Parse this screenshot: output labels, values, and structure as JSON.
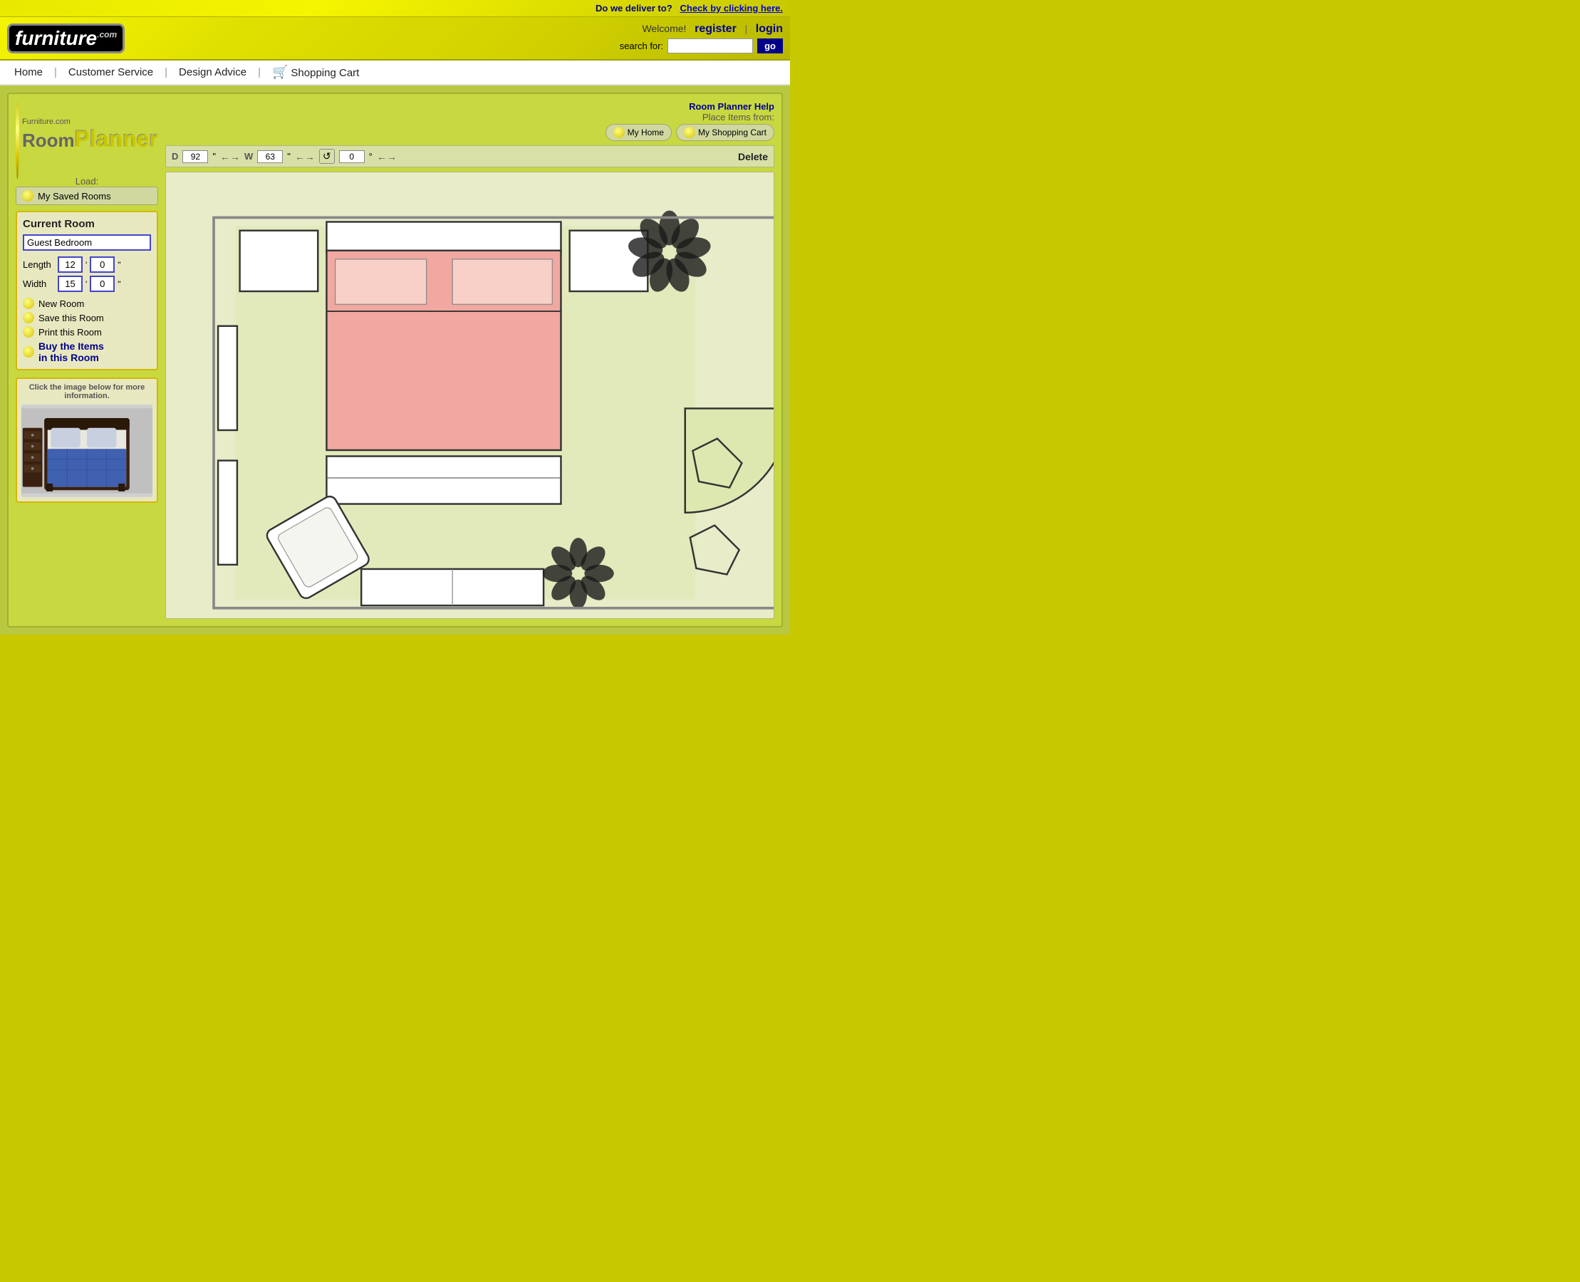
{
  "topbar": {
    "deliver_prompt": "Do we deliver to?",
    "deliver_link": "Check by clicking here."
  },
  "header": {
    "logo_brand": "furniture",
    "logo_com": ".com",
    "welcome": "Welcome!",
    "register": "register",
    "pipe": "|",
    "login": "login",
    "search_label": "search for:",
    "search_placeholder": "",
    "go_button": "go"
  },
  "nav": {
    "items": [
      {
        "label": "Home"
      },
      {
        "label": "Customer Service"
      },
      {
        "label": "Design Advice"
      },
      {
        "label": "Shopping Cart"
      }
    ]
  },
  "planner": {
    "logo_site": "Furniture.com",
    "logo_room": "Room",
    "logo_planner": "Planner",
    "load_label": "Load:",
    "load_btn": "My Saved Rooms",
    "help_link": "Room Planner Help",
    "place_label": "Place Items from:",
    "place_btn1": "My Home",
    "place_btn2": "My Shopping Cart",
    "dim_d_label": "D",
    "dim_d_value": "92",
    "dim_d_unit": "\"",
    "dim_w_label": "W",
    "dim_w_value": "63",
    "dim_w_unit": "\"",
    "dim_rot_value": "0",
    "dim_rot_unit": "°",
    "delete_label": "Delete",
    "current_room_title": "Current Room",
    "room_name": "Guest Bedroom",
    "length_label": "Length",
    "length_ft": "12",
    "length_in": "0",
    "width_label": "Width",
    "width_ft": "15",
    "width_in": "0",
    "ft_symbol": "'",
    "in_symbol": "\"",
    "new_room": "New Room",
    "save_room": "Save this Room",
    "print_room": "Print this Room",
    "buy_items1": "Buy the Items",
    "buy_items2": "in this Room",
    "preview_hint": "Click the image below for more information."
  }
}
